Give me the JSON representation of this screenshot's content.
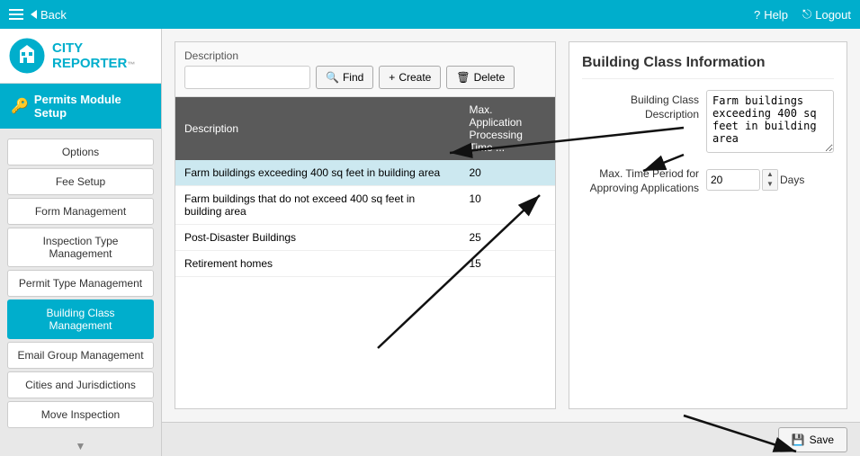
{
  "topnav": {
    "back_label": "Back",
    "help_label": "Help",
    "logout_label": "Logout"
  },
  "sidebar": {
    "logo_line1": "CITY",
    "logo_line2": "REPORTER",
    "logo_tm": "™",
    "module_label": "Permits Module Setup",
    "items": [
      {
        "id": "options",
        "label": "Options",
        "active": false
      },
      {
        "id": "fee-setup",
        "label": "Fee Setup",
        "active": false
      },
      {
        "id": "form-management",
        "label": "Form Management",
        "active": false
      },
      {
        "id": "inspection-type-management",
        "label": "Inspection Type Management",
        "active": false
      },
      {
        "id": "permit-type-management",
        "label": "Permit Type Management",
        "active": false
      },
      {
        "id": "building-class-management",
        "label": "Building Class Management",
        "active": true
      },
      {
        "id": "email-group-management",
        "label": "Email Group Management",
        "active": false
      },
      {
        "id": "cities-and-jurisdictions",
        "label": "Cities and Jurisdictions",
        "active": false
      },
      {
        "id": "move-inspection",
        "label": "Move Inspection",
        "active": false
      }
    ]
  },
  "table": {
    "description_label": "Description",
    "search_placeholder": "",
    "find_btn": "Find",
    "create_btn": "Create",
    "delete_btn": "Delete",
    "col_description": "Description",
    "col_max_time": "Max. Application Processing Time ...",
    "rows": [
      {
        "description": "Farm buildings exceeding 400 sq feet in building area",
        "max_time": "20",
        "selected": true
      },
      {
        "description": "Farm buildings that do not exceed 400 sq feet in building area",
        "max_time": "10",
        "selected": false
      },
      {
        "description": "Post-Disaster Buildings",
        "max_time": "25",
        "selected": false
      },
      {
        "description": "Retirement homes",
        "max_time": "15",
        "selected": false
      }
    ]
  },
  "info_panel": {
    "title": "Building Class Information",
    "building_class_desc_label": "Building Class Description",
    "building_class_desc_value": "Farm buildings exceeding 400 sq feet in building area",
    "max_time_label": "Max. Time Period for Approving Applications",
    "max_time_value": "20",
    "days_label": "Days"
  },
  "footer": {
    "save_label": "Save"
  }
}
